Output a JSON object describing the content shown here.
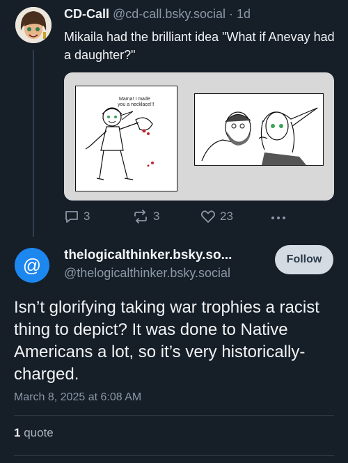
{
  "parent_post": {
    "author_name": "CD-Call",
    "author_handle": "@cd-call.bsky.social",
    "separator": "·",
    "time": "1d",
    "text": "Mikaila had the brilliant idea \"What if Anevay had a daughter?\"",
    "images": [
      {
        "alt": "sketch of a smiling child holding up a necklace",
        "caption": "Mama! I made you a necklace!!!"
      },
      {
        "alt": "sketch of a bearded man and an elf woman with green eyes"
      }
    ],
    "counts": {
      "replies": "3",
      "reposts": "3",
      "likes": "23"
    }
  },
  "reply_post": {
    "avatar_glyph": "@",
    "author_name": "thelogicalthinker.bsky.so...",
    "author_handle": "@thelogicalthinker.bsky.social",
    "follow_label": "Follow",
    "text": "Isn’t glorifying taking war trophies a racist thing to depict? It was done to Native Americans a lot, so it’s very historically-charged.",
    "timestamp": "March 8, 2025 at 6:08 AM",
    "quote_count": "1",
    "quote_label": "quote"
  },
  "colors": {
    "background": "#161e27",
    "accent": "#1d87f0",
    "muted": "#8a98a8"
  }
}
